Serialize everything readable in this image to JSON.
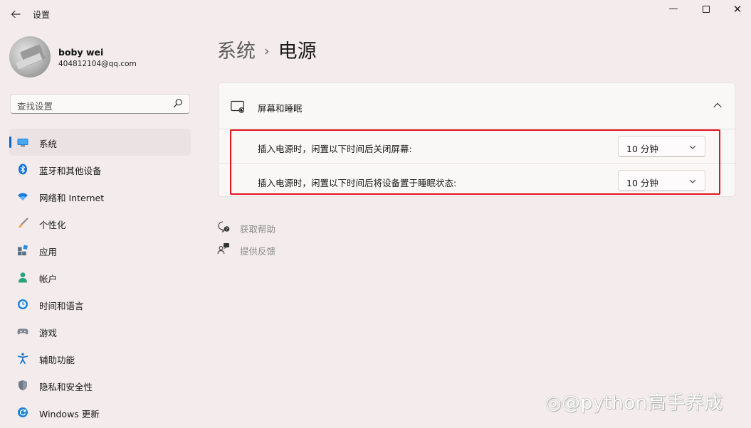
{
  "window": {
    "title": "设置",
    "back_icon": "back-arrow-icon",
    "controls": {
      "minimize": "—",
      "close": "✕"
    }
  },
  "profile": {
    "name": "boby wei",
    "email": "404812104@qq.com"
  },
  "search": {
    "placeholder": "查找设置"
  },
  "sidebar": {
    "items": [
      {
        "label": "系统",
        "icon": "system-display-icon",
        "selected": true
      },
      {
        "label": "蓝牙和其他设备",
        "icon": "bluetooth-icon"
      },
      {
        "label": "网络和 Internet",
        "icon": "wifi-icon"
      },
      {
        "label": "个性化",
        "icon": "brush-icon"
      },
      {
        "label": "应用",
        "icon": "apps-icon"
      },
      {
        "label": "帐户",
        "icon": "account-icon"
      },
      {
        "label": "时间和语言",
        "icon": "time-language-icon"
      },
      {
        "label": "游戏",
        "icon": "gamepad-icon"
      },
      {
        "label": "辅助功能",
        "icon": "accessibility-icon"
      },
      {
        "label": "隐私和安全性",
        "icon": "shield-icon"
      },
      {
        "label": "Windows 更新",
        "icon": "windows-update-icon"
      }
    ]
  },
  "breadcrumb": {
    "parent": "系统",
    "separator": "›",
    "current": "电源"
  },
  "screen_sleep": {
    "title": "屏幕和睡眠",
    "settings": [
      {
        "label": "插入电源时，闲置以下时间后关闭屏幕:",
        "value": "10 分钟"
      },
      {
        "label": "插入电源时，闲置以下时间后将设备置于睡眠状态:",
        "value": "10 分钟"
      }
    ]
  },
  "help": {
    "get_help": "获取帮助",
    "give_feedback": "提供反馈"
  },
  "watermark": "◎@python高手养成",
  "colors": {
    "accent": "#0a64c4",
    "highlight_border": "#e0141e",
    "background": "#f4ecec"
  }
}
